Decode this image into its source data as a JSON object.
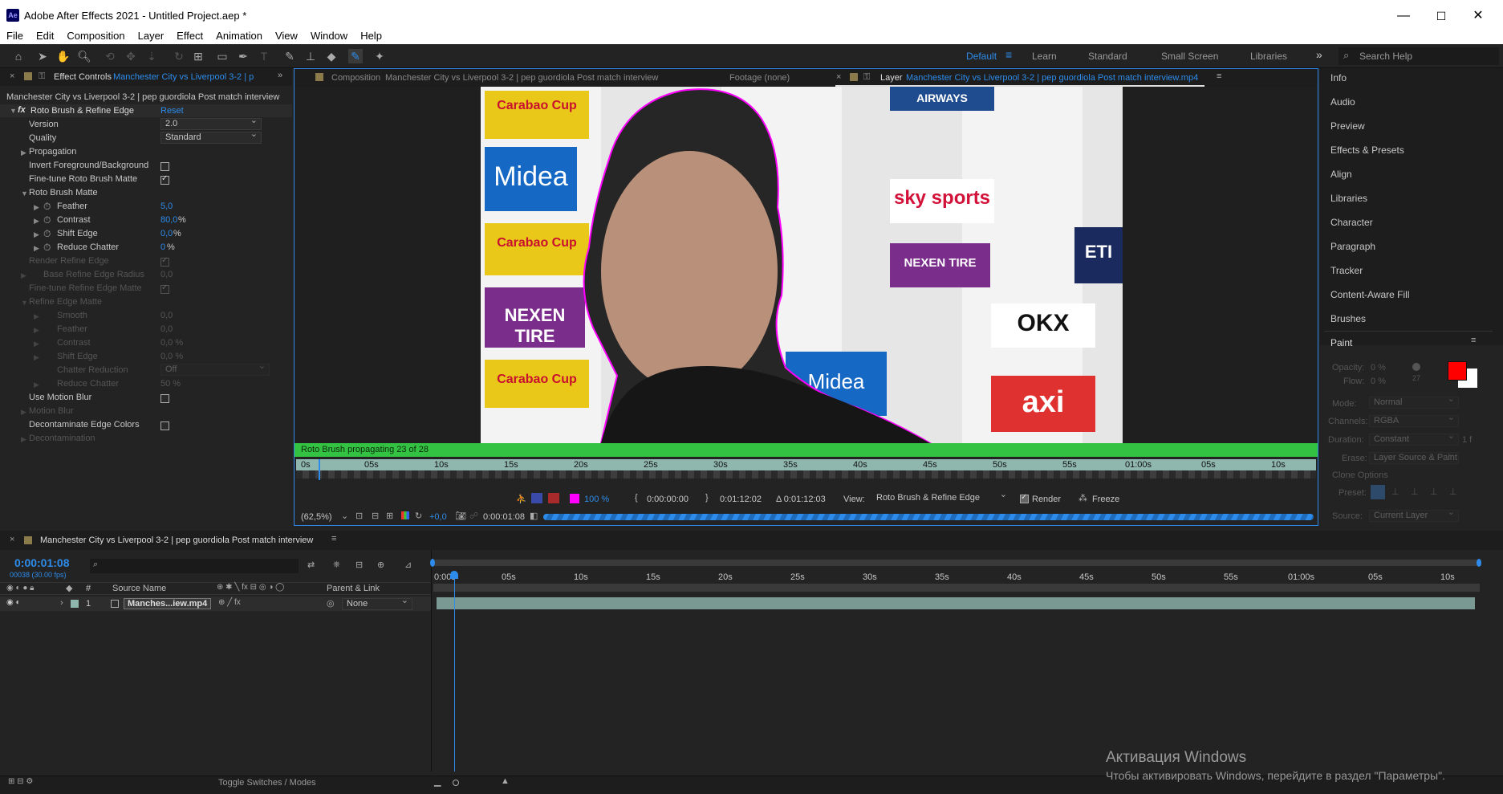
{
  "app": {
    "logo": "Ae",
    "title": "Adobe After Effects 2021 - Untitled Project.aep *",
    "win_minimize": "—",
    "win_maximize": "☐",
    "win_close": "✕"
  },
  "menu": [
    "File",
    "Edit",
    "Composition",
    "Layer",
    "Effect",
    "Animation",
    "View",
    "Window",
    "Help"
  ],
  "workspaces": {
    "default": "Default",
    "learn": "Learn",
    "standard": "Standard",
    "small_screen": "Small Screen",
    "libraries": "Libraries",
    "more": "»"
  },
  "search_help": {
    "placeholder": "Search Help"
  },
  "effect_controls": {
    "tab_label": "Effect Controls",
    "tab_target": "Manchester City vs Liverpool 3-2 | p",
    "layer_path": "Manchester City vs Liverpool 3-2 | pep guordiola Post match interview",
    "effect_name": "Roto Brush & Refine Edge",
    "reset": "Reset",
    "version_label": "Version",
    "version_value": "2.0",
    "quality_label": "Quality",
    "quality_value": "Standard",
    "propagation": "Propagation",
    "invert_fg_bg": "Invert Foreground/Background",
    "fine_tune_roto": "Fine-tune Roto Brush Matte",
    "roto_brush_matte": "Roto Brush Matte",
    "feather_label": "Feather",
    "feather_value": "5,0",
    "contrast_label": "Contrast",
    "contrast_value": "80,0",
    "contrast_unit": "%",
    "shift_edge_label": "Shift Edge",
    "shift_edge_value": "0,0",
    "shift_edge_unit": "%",
    "reduce_chatter_label": "Reduce Chatter",
    "reduce_chatter_value": "0",
    "reduce_chatter_unit": "%",
    "render_refine_edge": "Render Refine Edge",
    "base_refine_radius_label": "Base Refine Edge Radius",
    "base_refine_radius_value": "0,0",
    "fine_tune_refine": "Fine-tune Refine Edge Matte",
    "refine_edge_matte": "Refine Edge Matte",
    "smooth_label": "Smooth",
    "smooth_value": "0,0",
    "r_feather_label": "Feather",
    "r_feather_value": "0,0",
    "r_contrast_label": "Contrast",
    "r_contrast_value": "0,0 %",
    "r_shift_label": "Shift Edge",
    "r_shift_value": "0,0 %",
    "chatter_reduction_label": "Chatter Reduction",
    "chatter_reduction_value": "Off",
    "r_reduce_label": "Reduce Chatter",
    "r_reduce_value": "50 %",
    "use_motion_blur": "Use Motion Blur",
    "motion_blur": "Motion Blur",
    "decontaminate": "Decontaminate Edge Colors",
    "decontamination": "Decontamination"
  },
  "viewer": {
    "tab_composition_label": "Composition",
    "tab_composition": "Manchester City vs Liverpool 3-2 | pep guordiola Post match interview",
    "tab_footage": "Footage (none)",
    "tab_layer_label": "Layer",
    "tab_layer": "Manchester City vs Liverpool 3-2 | pep guordiola Post match interview.mp4",
    "status": "Roto Brush propagating 23 of 28",
    "ruler": [
      "0s",
      "05s",
      "10s",
      "15s",
      "20s",
      "25s",
      "30s",
      "35s",
      "40s",
      "45s",
      "50s",
      "55s",
      "01:00s",
      "05s",
      "10s"
    ],
    "zoom_percent": "100 %",
    "in_time": "0:00:00:00",
    "out_time": "0:01:12:02",
    "duration": "Δ 0:01:12:03",
    "view_label": "View:",
    "view_value": "Roto Brush & Refine Edge",
    "render": "Render",
    "freeze": "Freeze",
    "magnification": "(62,5%)",
    "exposure": "+0,0",
    "current_time": "0:00:01:08",
    "backdrop_brands": [
      "Carabao Cup",
      "Midea",
      "sky sports",
      "NEXEN TIRE",
      "OKX",
      "axi",
      "AIRWAYS",
      "ETI"
    ]
  },
  "right_panel": {
    "items": [
      "Info",
      "Audio",
      "Preview",
      "Effects & Presets",
      "Align",
      "Libraries",
      "Character",
      "Paragraph",
      "Tracker",
      "Content-Aware Fill",
      "Brushes"
    ],
    "paint": {
      "title": "Paint",
      "opacity_label": "Opacity:",
      "opacity_value": "0 %",
      "flow_label": "Flow:",
      "flow_value": "0 %",
      "brush_size": "27",
      "mode_label": "Mode:",
      "mode_value": "Normal",
      "channels_label": "Channels:",
      "channels_value": "RGBA",
      "duration_label": "Duration:",
      "duration_value": "Constant",
      "duration_frames": "1 f",
      "erase_label": "Erase:",
      "erase_value": "Layer Source & Paint",
      "clone_options": "Clone Options",
      "preset_label": "Preset:",
      "source_label": "Source:",
      "source_value": "Current Layer",
      "fg_color": "#ff0000",
      "bg_color": "#ffffff"
    }
  },
  "timeline": {
    "comp_name": "Manchester City vs Liverpool 3-2 | pep guordiola Post match interview",
    "current_time": "0:00:01:08",
    "frame_info": "00038 (30.00 fps)",
    "source_name_header": "Source Name",
    "parent_link_header": "Parent & Link",
    "hash_header": "#",
    "layer_index": "1",
    "layer_name": "Manches...iew.mp4",
    "parent_value": "None",
    "ruler": [
      "0:00s",
      "05s",
      "10s",
      "15s",
      "20s",
      "25s",
      "30s",
      "35s",
      "40s",
      "45s",
      "50s",
      "55s",
      "01:00s",
      "05s",
      "10s"
    ],
    "toggle": "Toggle Switches / Modes"
  },
  "watermark": {
    "line1": "Активация Windows",
    "line2": "Чтобы активировать Windows, перейдите в раздел \"Параметры\"."
  }
}
